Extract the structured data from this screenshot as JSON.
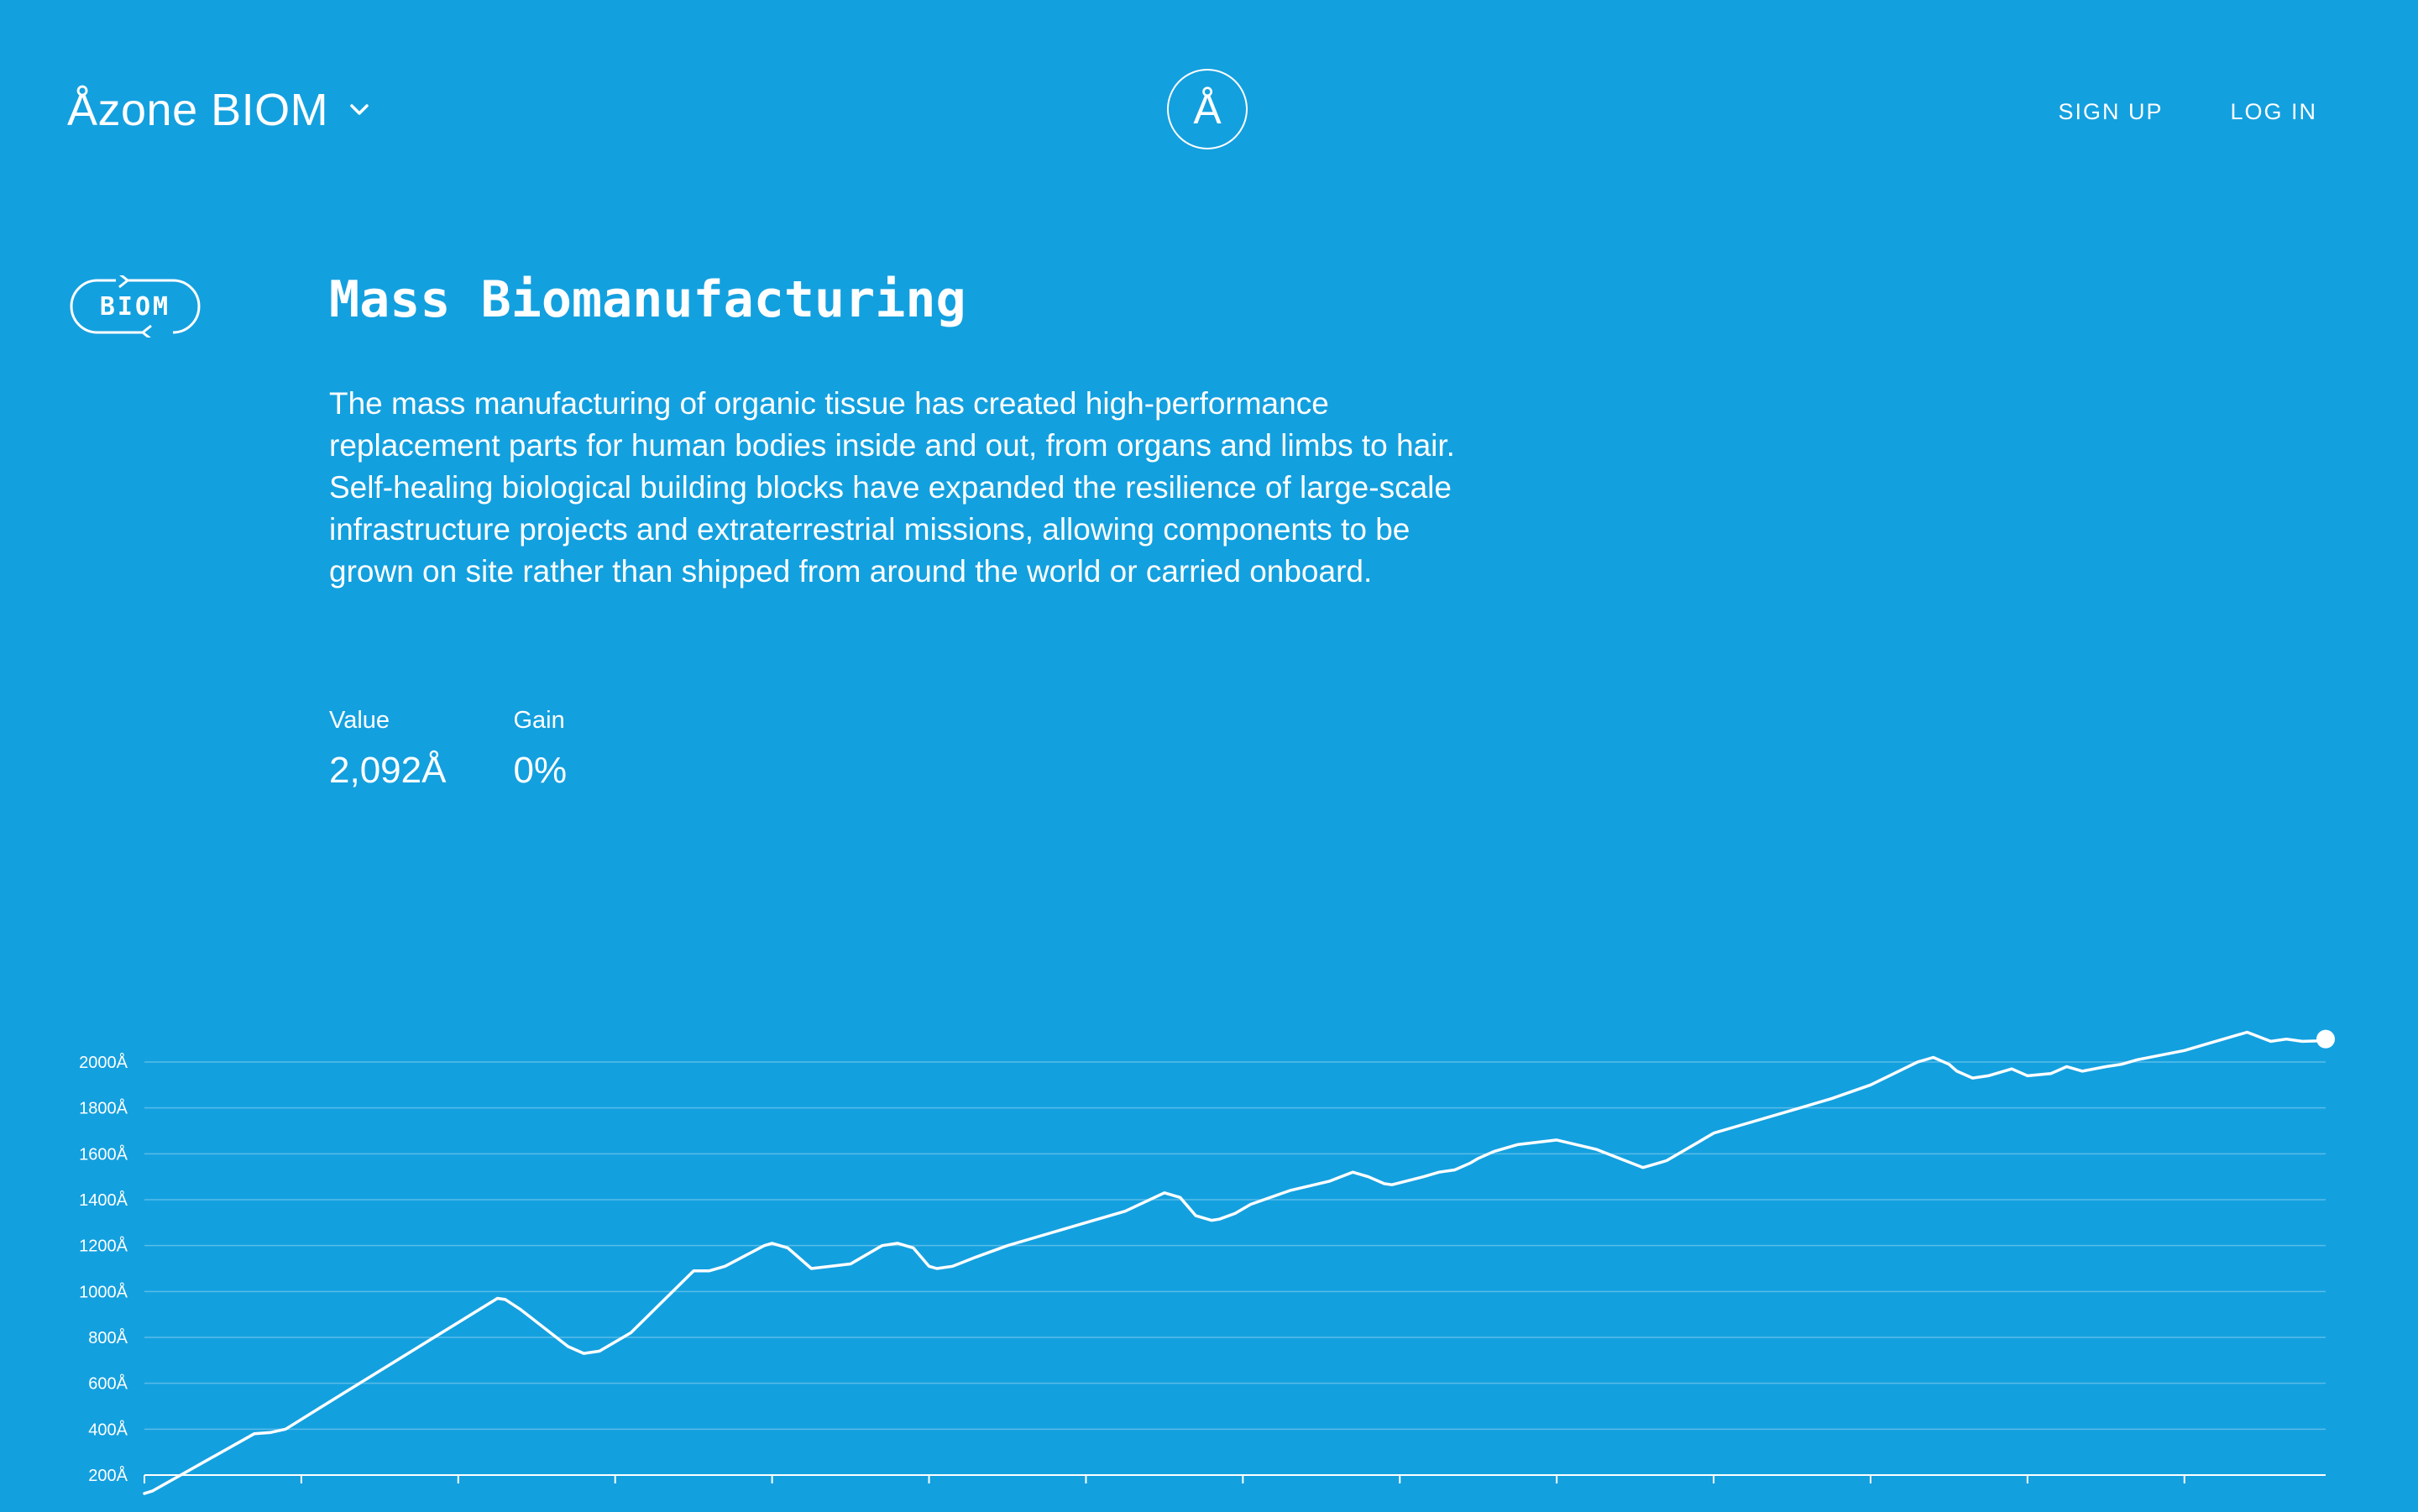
{
  "header": {
    "brand": "Åzone BIOM",
    "logo_glyph": "Å",
    "nav": {
      "signup": "SIGN UP",
      "login": "LOG IN"
    }
  },
  "badge": {
    "label": "BIOM"
  },
  "main": {
    "title": "Mass Biomanufacturing",
    "description": "The mass manufacturing of organic tissue has created high-performance replacement parts for human bodies inside and out, from organs and limbs to hair. Self-healing biological building blocks have expanded the resilience of large-scale infrastructure projects and extraterrestrial missions, allowing components to be grown on site rather than shipped from around the world or carried onboard.",
    "stats": {
      "value_label": "Value",
      "value": "2,092Å",
      "gain_label": "Gain",
      "gain": "0%"
    }
  },
  "colors": {
    "background": "#13a0df",
    "foreground": "#ffffff"
  },
  "chart_data": {
    "type": "line",
    "ylim": [
      200,
      2000
    ],
    "yticks": [
      "2000Å",
      "1800Å",
      "1600Å",
      "1400Å",
      "1200Å",
      "1000Å",
      "800Å",
      "600Å",
      "400Å",
      "200Å"
    ],
    "ytick_values": [
      2000,
      1800,
      1600,
      1400,
      1200,
      1000,
      800,
      600,
      400,
      200
    ],
    "xlim": [
      0,
      278
    ],
    "grid": true,
    "series": [
      {
        "x": [
          0,
          1,
          14,
          16,
          18,
          26,
          45,
          46,
          48,
          54,
          56,
          58,
          62,
          70,
          72,
          74,
          79,
          80,
          82,
          85,
          90,
          94,
          96,
          98,
          100,
          101,
          103,
          106,
          110,
          115,
          120,
          125,
          130,
          132,
          134,
          136,
          137,
          139,
          141,
          146,
          151,
          154,
          156,
          158,
          159,
          163,
          165,
          167,
          169,
          170,
          172,
          175,
          180,
          185,
          191,
          193,
          194,
          196,
          198,
          200,
          203,
          210,
          215,
          220,
          226,
          228,
          230,
          231,
          233,
          235,
          236,
          238,
          240,
          243,
          245,
          247,
          250,
          252,
          254,
          257,
          260,
          263,
          268,
          271,
          273,
          275,
          277,
          278
        ],
        "y": [
          120,
          130,
          380,
          385,
          400,
          570,
          970,
          965,
          920,
          760,
          730,
          740,
          820,
          1090,
          1090,
          1110,
          1200,
          1210,
          1190,
          1100,
          1120,
          1200,
          1210,
          1190,
          1110,
          1100,
          1110,
          1150,
          1200,
          1250,
          1300,
          1350,
          1430,
          1410,
          1330,
          1310,
          1315,
          1340,
          1380,
          1440,
          1480,
          1520,
          1500,
          1470,
          1465,
          1500,
          1520,
          1530,
          1560,
          1580,
          1610,
          1640,
          1660,
          1620,
          1540,
          1560,
          1570,
          1610,
          1650,
          1690,
          1720,
          1790,
          1840,
          1900,
          2000,
          2020,
          1990,
          1960,
          1930,
          1940,
          1950,
          1970,
          1940,
          1950,
          1980,
          1960,
          1980,
          1990,
          2010,
          2030,
          2050,
          2080,
          2130,
          2090,
          2100,
          2090,
          2092,
          2100
        ]
      }
    ]
  }
}
